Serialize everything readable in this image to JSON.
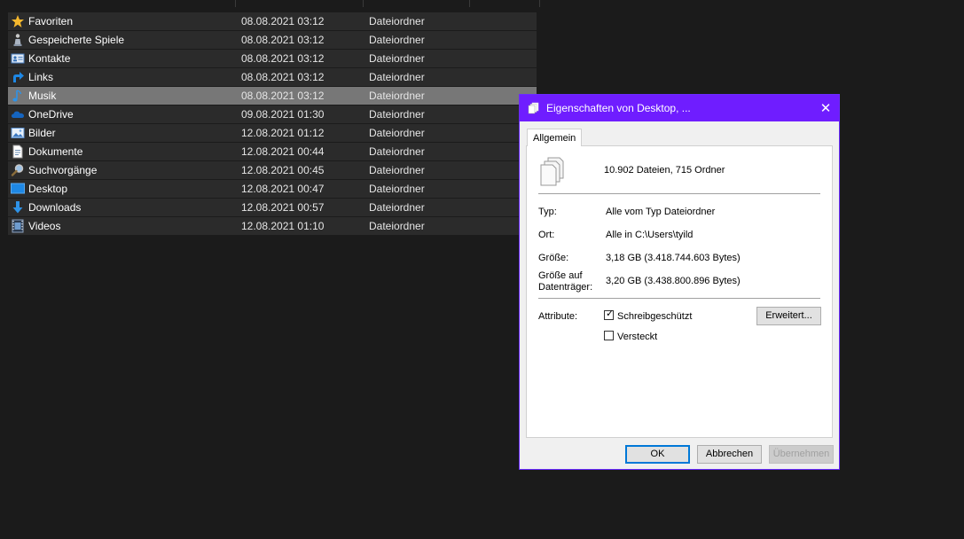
{
  "explorer": {
    "files": [
      {
        "name": "Favoriten",
        "date": "08.08.2021 03:12",
        "type": "Dateiordner",
        "icon": "star-icon",
        "selected": false
      },
      {
        "name": "Gespeicherte Spiele",
        "date": "08.08.2021 03:12",
        "type": "Dateiordner",
        "icon": "chess-piece-icon",
        "selected": false
      },
      {
        "name": "Kontakte",
        "date": "08.08.2021 03:12",
        "type": "Dateiordner",
        "icon": "contact-card-icon",
        "selected": false
      },
      {
        "name": "Links",
        "date": "08.08.2021 03:12",
        "type": "Dateiordner",
        "icon": "link-arrow-icon",
        "selected": false
      },
      {
        "name": "Musik",
        "date": "08.08.2021 03:12",
        "type": "Dateiordner",
        "icon": "music-note-icon",
        "selected": true
      },
      {
        "name": "OneDrive",
        "date": "09.08.2021 01:30",
        "type": "Dateiordner",
        "icon": "cloud-icon",
        "selected": false
      },
      {
        "name": "Bilder",
        "date": "12.08.2021 01:12",
        "type": "Dateiordner",
        "icon": "picture-icon",
        "selected": false
      },
      {
        "name": "Dokumente",
        "date": "12.08.2021 00:44",
        "type": "Dateiordner",
        "icon": "document-icon",
        "selected": false
      },
      {
        "name": "Suchvorgänge",
        "date": "12.08.2021 00:45",
        "type": "Dateiordner",
        "icon": "search-icon",
        "selected": false
      },
      {
        "name": "Desktop",
        "date": "12.08.2021 00:47",
        "type": "Dateiordner",
        "icon": "desktop-icon",
        "selected": false
      },
      {
        "name": "Downloads",
        "date": "12.08.2021 00:57",
        "type": "Dateiordner",
        "icon": "download-arrow-icon",
        "selected": false
      },
      {
        "name": "Videos",
        "date": "12.08.2021 01:10",
        "type": "Dateiordner",
        "icon": "film-icon",
        "selected": false
      }
    ]
  },
  "dialog": {
    "title": "Eigenschaften von Desktop, ...",
    "close_glyph": "✕",
    "tab_label": "Allgemein",
    "summary": "10.902 Dateien, 715 Ordner",
    "type_label": "Typ:",
    "type_value": "Alle vom Typ Dateiordner",
    "location_label": "Ort:",
    "location_value": "Alle in C:\\Users\\tyild",
    "size_label": "Größe:",
    "size_value": "3,18 GB (3.418.744.603 Bytes)",
    "disk_size_label_1": "Größe auf",
    "disk_size_label_2": "Datenträger:",
    "disk_size_value": "3,20 GB (3.438.800.896 Bytes)",
    "attributes_label": "Attribute:",
    "readonly_label": "Schreibgeschützt",
    "readonly_checked": true,
    "hidden_label": "Versteckt",
    "hidden_checked": false,
    "advanced_button": "Erweitert...",
    "ok_button": "OK",
    "cancel_button": "Abbrechen",
    "apply_button": "Übernehmen"
  },
  "colors": {
    "titlebar": "#6f1dff",
    "row_bg": "#2b2b2b",
    "row_selected": "#777777",
    "desktop_bg": "#1b1b1b"
  }
}
